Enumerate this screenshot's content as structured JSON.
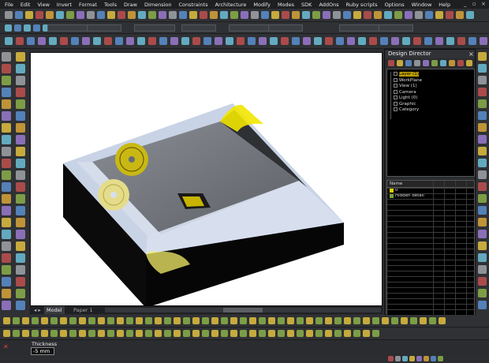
{
  "menu": [
    "File",
    "Edit",
    "View",
    "Invert",
    "Format",
    "Tools",
    "Draw",
    "Dimension",
    "Constraints",
    "Architecture",
    "Modify",
    "Modes",
    "SDK",
    "AddOns",
    "Ruby scripts",
    "Options",
    "Window",
    "Help"
  ],
  "window_controls": {
    "minimize": "_",
    "restore": "▫",
    "close": "×"
  },
  "design_director": {
    "title": "Design Director",
    "close": "×",
    "tree": [
      {
        "label": "Layer (1)",
        "selected": true
      },
      {
        "label": "WorkPlane",
        "selected": false
      },
      {
        "label": "View (1)",
        "selected": false
      },
      {
        "label": "Camera",
        "selected": false
      },
      {
        "label": "Light (0)",
        "selected": false
      },
      {
        "label": "Graphic",
        "selected": false
      },
      {
        "label": "Category",
        "selected": false
      }
    ],
    "layers_header": "Name",
    "layers": [
      {
        "name": "0"
      },
      {
        "name": "Hidden detail"
      }
    ]
  },
  "view_tabs": [
    "Model",
    "Paper 1"
  ],
  "status": {
    "field_label": "Thickness",
    "field_value": "-5 mm"
  },
  "colors": {
    "accent": "#f0d400",
    "background": "#2b2d30",
    "viewport": "#ffffff"
  }
}
